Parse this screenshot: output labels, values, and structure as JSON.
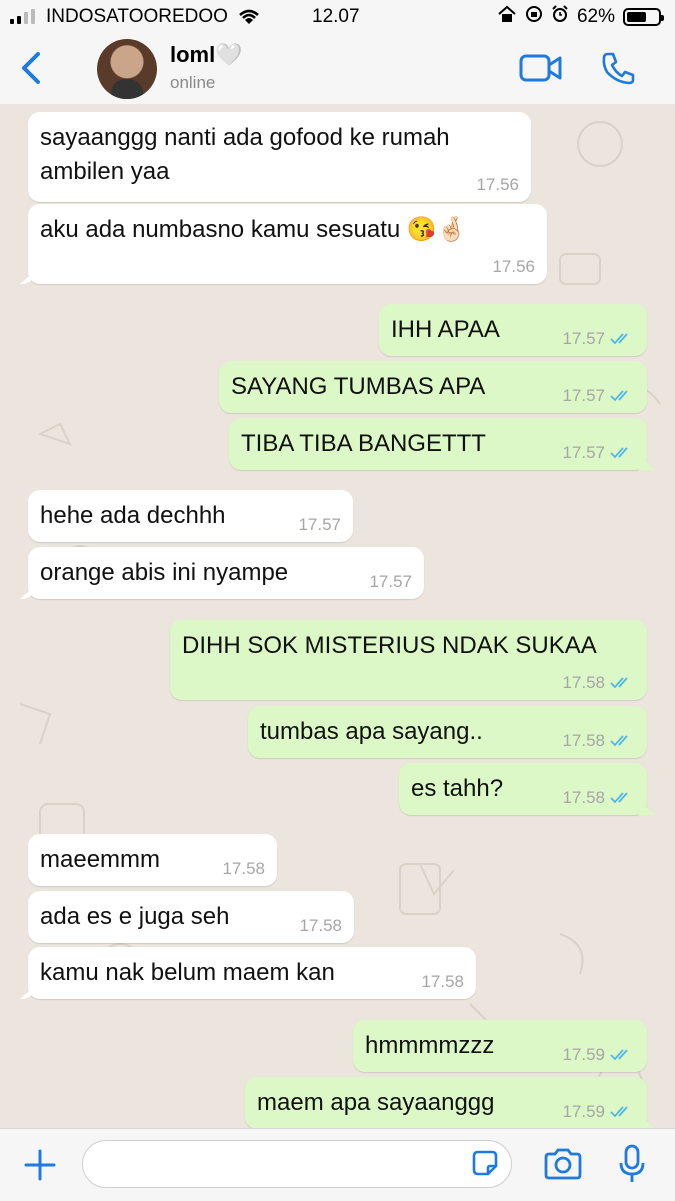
{
  "status_bar": {
    "carrier": "INDOSATOOREDOO",
    "time": "12.07",
    "battery_percent": "62%",
    "battery_level": 0.62
  },
  "header": {
    "contact_name": "loml🤍",
    "status": "online"
  },
  "messages": [
    {
      "dir": "in",
      "text": "sayaanggg nanti ada gofood ke rumah\nambilen yaa",
      "time": "17.56"
    },
    {
      "dir": "in",
      "text": "aku ada numbasno kamu sesuatu 😘🤞🏻",
      "time": "17.56"
    },
    {
      "dir": "out",
      "text": "IHH APAA",
      "time": "17.57"
    },
    {
      "dir": "out",
      "text": "SAYANG TUMBAS APA",
      "time": "17.57"
    },
    {
      "dir": "out",
      "text": "TIBA TIBA BANGETTT",
      "time": "17.57"
    },
    {
      "dir": "in",
      "text": "hehe ada dechhh",
      "time": "17.57"
    },
    {
      "dir": "in",
      "text": "orange abis ini nyampe",
      "time": "17.57"
    },
    {
      "dir": "out",
      "text": "DIHH SOK MISTERIUS NDAK SUKAA",
      "time": "17.58"
    },
    {
      "dir": "out",
      "text": "tumbas apa sayang..",
      "time": "17.58"
    },
    {
      "dir": "out",
      "text": "es tahh?",
      "time": "17.58"
    },
    {
      "dir": "in",
      "text": "maeemmm",
      "time": "17.58"
    },
    {
      "dir": "in",
      "text": "ada es e juga seh",
      "time": "17.58"
    },
    {
      "dir": "in",
      "text": "kamu nak belum maem kan",
      "time": "17.58"
    },
    {
      "dir": "out",
      "text": "hmmmmzzz",
      "time": "17.59"
    },
    {
      "dir": "out",
      "text": "maem apa sayaanggg",
      "time": "17.59"
    }
  ],
  "input": {
    "placeholder": ""
  },
  "colors": {
    "incoming_bubble": "#FFFFFF",
    "outgoing_bubble": "#DCF8C6",
    "chat_background": "#ECE5DD",
    "accent_blue": "#1F7AE0",
    "read_tick": "#4FB6EC"
  },
  "icons": [
    "back-chevron-icon",
    "video-call-icon",
    "phone-call-icon",
    "plus-icon",
    "sticker-icon",
    "camera-icon",
    "microphone-icon",
    "wifi-icon",
    "signal-icon",
    "battery-icon",
    "read-ticks-icon"
  ]
}
